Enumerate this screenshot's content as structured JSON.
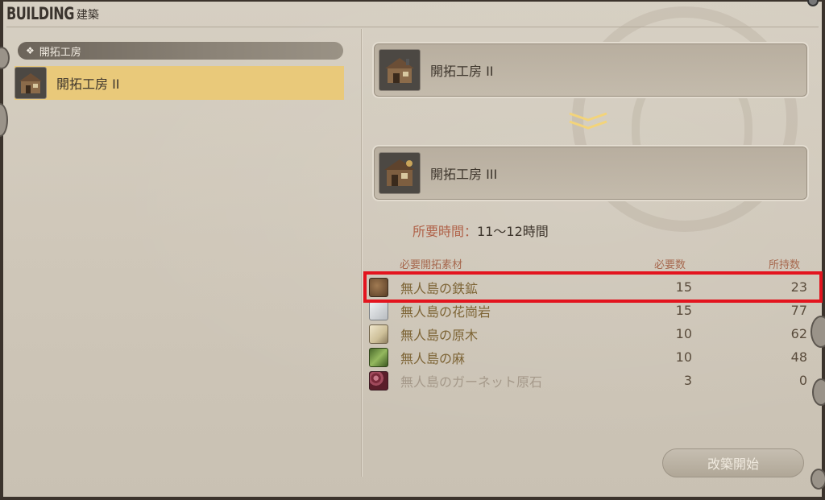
{
  "window": {
    "title_main": "BUILDING",
    "title_sub": "建築"
  },
  "left_panel": {
    "category": "開拓工房",
    "selected_item": "開拓工房 II"
  },
  "upgrade": {
    "from_label": "開拓工房 II",
    "to_label": "開拓工房 III",
    "time_label": "所要時間",
    "time_separator": "：",
    "time_value": "11～12時間"
  },
  "materials": {
    "headers": {
      "name": "必要開拓素材",
      "required": "必要数",
      "owned": "所持数"
    },
    "rows": [
      {
        "name": "無人島の鉄鉱",
        "required": "15",
        "owned": "23",
        "icon": "iron-ore-icon",
        "color": "#7a5a3a"
      },
      {
        "name": "無人島の花崗岩",
        "required": "15",
        "owned": "77",
        "icon": "granite-icon",
        "color": "#cfd3d6"
      },
      {
        "name": "無人島の原木",
        "required": "10",
        "owned": "62",
        "icon": "log-icon",
        "color": "#d9cfb4"
      },
      {
        "name": "無人島の麻",
        "required": "10",
        "owned": "48",
        "icon": "hemp-icon",
        "color": "#7a9a4a"
      },
      {
        "name": "無人島のガーネット原石",
        "required": "3",
        "owned": "0",
        "icon": "garnet-icon",
        "color": "#8a3a4a"
      }
    ]
  },
  "actions": {
    "start_label": "改築開始"
  },
  "colors": {
    "highlight": "#e3141e",
    "selected_row": "#e9c97a",
    "accent_label": "#b0634a"
  }
}
